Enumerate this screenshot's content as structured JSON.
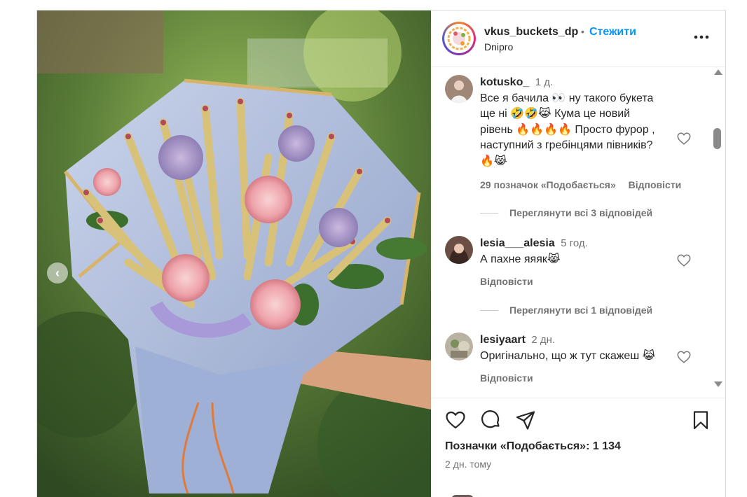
{
  "post": {
    "photo_alt": "bouquet",
    "prev_icon": "chevron-left-icon"
  },
  "header": {
    "username": "vkus_buckets_dp",
    "separator": "•",
    "follow_label": "Стежити",
    "location": "Dnipro",
    "more_icon": "more-horizontal-icon"
  },
  "comments": [
    {
      "username": "kotusko_",
      "time": "1 д.",
      "lines": [
        "Все я бачила 👀 ну такого букета",
        "ще ні 🤣🤣😹 Кума це новий",
        "рівень 🔥🔥🔥🔥 Просто фурор ,",
        "наступний з гребінцями півників?",
        "🔥😹"
      ],
      "likes_label": "29 позначок «Подобається»",
      "reply_label": "Відповісти",
      "view_replies": "Переглянути всі 3 відповідей"
    },
    {
      "username": "lesia___alesia",
      "time": "5 год.",
      "lines": [
        "А пахне яяяк😹"
      ],
      "reply_label": "Відповісти",
      "view_replies": "Переглянути всі 1 відповідей"
    },
    {
      "username": "lesiyaart",
      "time": "2 дн.",
      "lines": [
        "Оригінально, що ж тут скажеш 😹"
      ],
      "reply_label": "Відповісти"
    }
  ],
  "actions": {
    "like_icon": "heart-icon",
    "comment_icon": "comment-icon",
    "share_icon": "send-icon",
    "save_icon": "bookmark-icon",
    "likes_text": "Позначки «Подобається»: 1 134",
    "date_text": "2 дн. тому"
  },
  "colors": {
    "accent": "#0095f6",
    "muted": "#737373",
    "text": "#262626"
  }
}
